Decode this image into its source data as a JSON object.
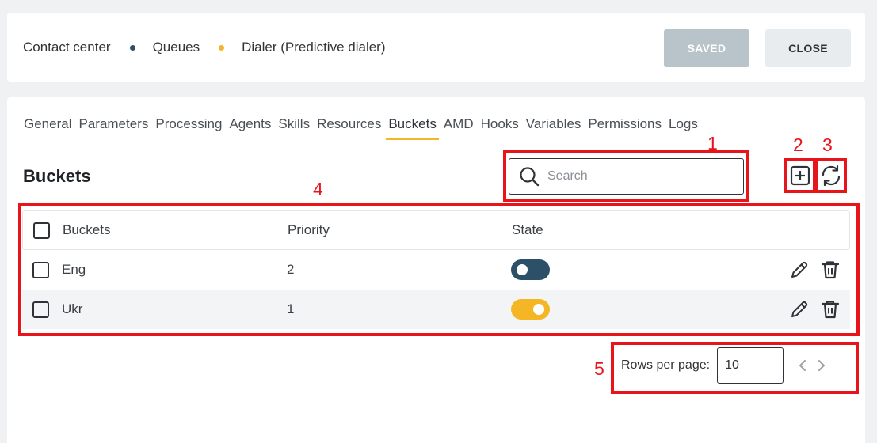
{
  "breadcrumb": {
    "items": [
      "Contact center",
      "Queues",
      "Dialer (Predictive dialer)"
    ],
    "dot_colors": [
      "#2d5069",
      "#f4b624"
    ]
  },
  "header": {
    "saved_label": "SAVED",
    "close_label": "CLOSE"
  },
  "tabs": [
    {
      "label": "General"
    },
    {
      "label": "Parameters"
    },
    {
      "label": "Processing"
    },
    {
      "label": "Agents"
    },
    {
      "label": "Skills"
    },
    {
      "label": "Resources"
    },
    {
      "label": "Buckets",
      "active": true
    },
    {
      "label": "AMD"
    },
    {
      "label": "Hooks"
    },
    {
      "label": "Variables"
    },
    {
      "label": "Permissions"
    },
    {
      "label": "Logs"
    }
  ],
  "section": {
    "title": "Buckets",
    "search_placeholder": "Search",
    "search_value": ""
  },
  "table": {
    "columns": [
      "Buckets",
      "Priority",
      "State"
    ],
    "rows": [
      {
        "name": "Eng",
        "priority": "2",
        "state": "off"
      },
      {
        "name": "Ukr",
        "priority": "1",
        "state": "on"
      }
    ]
  },
  "pagination": {
    "rows_per_page_label": "Rows per page:",
    "rows_per_page_value": "10"
  },
  "annotations": [
    "1",
    "2",
    "3",
    "4",
    "5"
  ],
  "colors": {
    "accent": "#f4b624",
    "primary": "#2d5069",
    "annotation": "#e8141c"
  }
}
